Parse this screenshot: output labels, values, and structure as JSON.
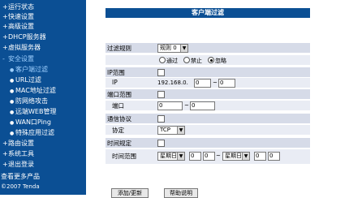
{
  "sidebar": {
    "items": [
      {
        "label": "运行状态"
      },
      {
        "label": "快速设置"
      },
      {
        "label": "高级设置"
      },
      {
        "label": "DHCP服务器"
      },
      {
        "label": "虚拟服务器"
      },
      {
        "label": "安全设置"
      },
      {
        "label": "客户端过滤"
      },
      {
        "label": "URL过滤"
      },
      {
        "label": "MAC地址过滤"
      },
      {
        "label": "防网络攻击"
      },
      {
        "label": "远端WEB管理"
      },
      {
        "label": "WAN口Ping"
      },
      {
        "label": "特殊应用过滤"
      },
      {
        "label": "路由设置"
      },
      {
        "label": "系统工具"
      },
      {
        "label": "退出登录"
      }
    ],
    "more_link": "查看更多产品",
    "copyright": "©2007 Tenda"
  },
  "form": {
    "title": "客户端过滤",
    "filter_rule_label": "过滤规则",
    "filter_rule_value": "规则 0",
    "radio_pass": "通过",
    "radio_deny": "禁止",
    "radio_ignore": "忽略",
    "ip_range_label": "IP范围",
    "ip_label": "IP",
    "ip_prefix": "192.168.0.",
    "ip_start": "0",
    "ip_sep": "~",
    "ip_end": "0",
    "port_range_label": "端口范围",
    "port_label": "端口",
    "port_start": "0",
    "port_sep": "~",
    "port_end": "0",
    "protocol_section_label": "通信协议",
    "protocol_label": "协定",
    "protocol_value": "TCP",
    "time_section_label": "时间规定",
    "time_range_label": "时间范围",
    "day_start": "星期日",
    "hour_start": "0",
    "min_start": "0",
    "time_sep": "~",
    "day_end": "星期日",
    "hour_end": "0",
    "min_end": "0"
  },
  "buttons": {
    "add_update": "添加/更新",
    "help": "帮助说明"
  }
}
